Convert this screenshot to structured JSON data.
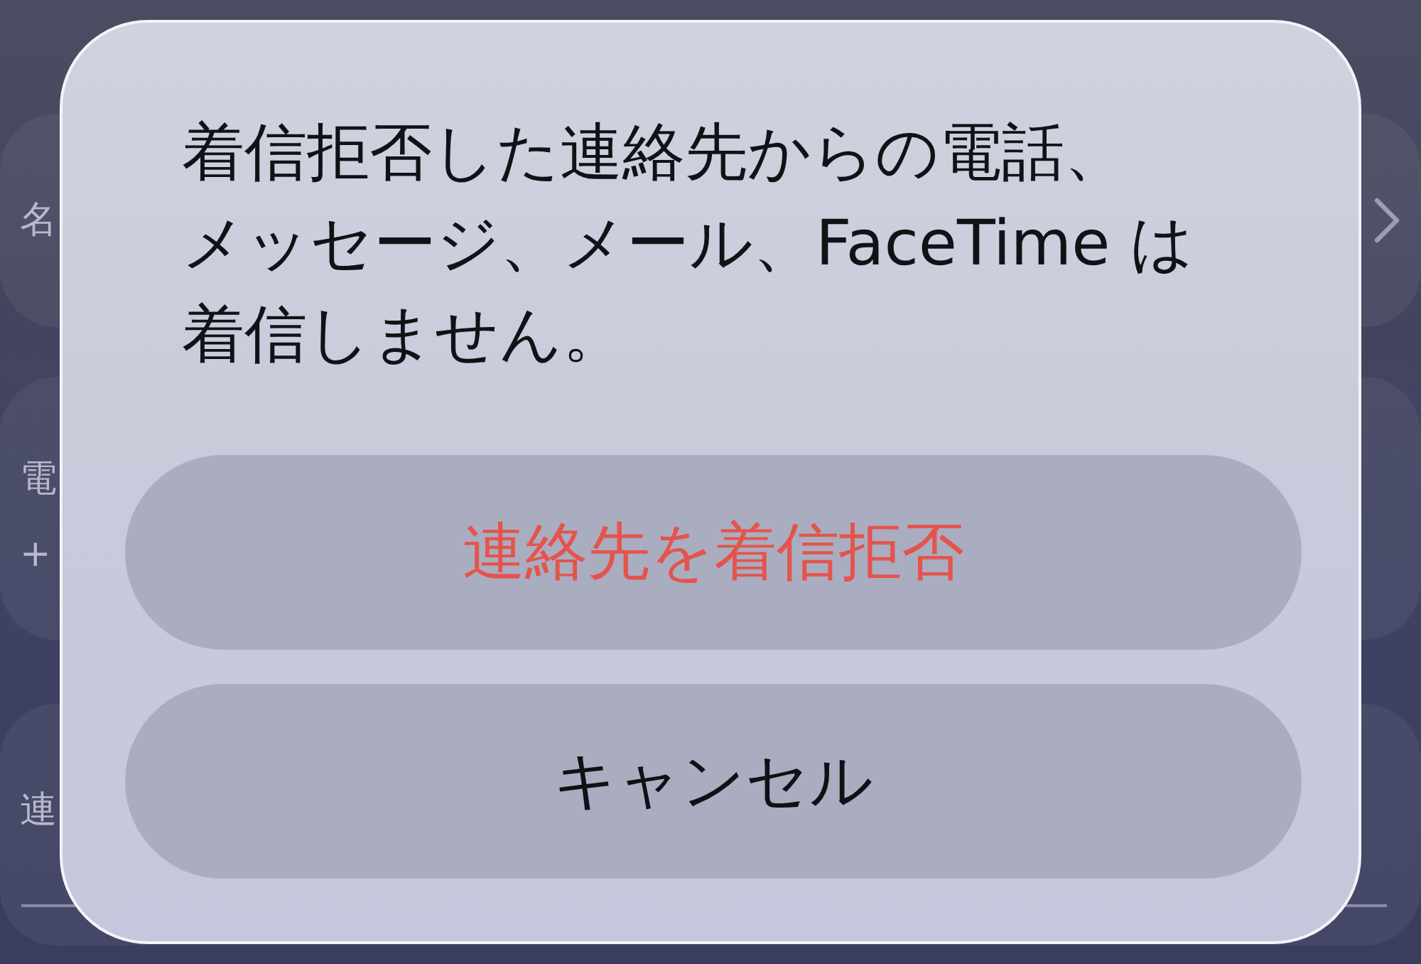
{
  "background": {
    "groups": [
      {
        "rows": [
          {
            "label": "名",
            "chevron": true
          }
        ]
      },
      {
        "rows": [
          {
            "label": "電",
            "chevron": false
          },
          {
            "label": "+",
            "chevron": false
          }
        ]
      },
      {
        "rows": [
          {
            "label": "連",
            "chevron": false
          }
        ],
        "separator": true
      }
    ]
  },
  "alert": {
    "message": "着信拒否した連絡先からの電話、メッセージ、メール、FaceTime は着信しません。",
    "buttons": [
      {
        "label": "連絡先を着信拒否",
        "kind": "destructive"
      },
      {
        "label": "キャンセル",
        "kind": "cancel"
      }
    ]
  }
}
